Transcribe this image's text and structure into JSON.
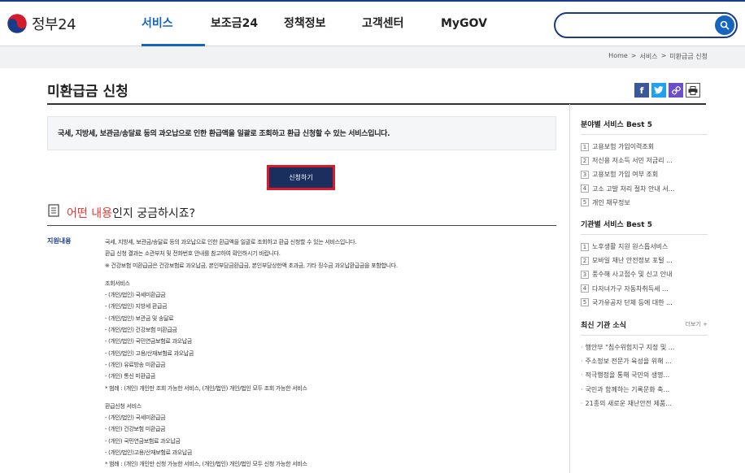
{
  "header": {
    "brand": "정부24",
    "nav": [
      "서비스",
      "보조금24",
      "정책정보",
      "고객센터",
      "MyGOV"
    ],
    "active_nav": "서비스",
    "search_placeholder": ""
  },
  "breadcrumb": [
    "Home",
    ">",
    "서비스",
    ">",
    "미환급금 신청"
  ],
  "page": {
    "title": "미환급금 신청",
    "summary": "국세, 지방세, 보관금/송달료 등의 과오납으로 인한 환급액을 일괄로 조회하고 환급 신청할 수 있는 서비스입니다.",
    "apply_label": "신청하기",
    "section_prefix": "어떤 내용",
    "section_suffix": "인지 궁금하시죠?"
  },
  "details": {
    "label": "지원내용",
    "lines": [
      "국세, 지방세, 보관금/송달료 등의 과오납으로 인한 환급액을 일괄로 조회하고 환급 신청할 수 있는 서비스입니다.",
      "환급 신청 결과는 소관부처 및 전화번호 안내를 참고하여 확인하시기 바랍니다.",
      "※ 건강보험 미환급금은 건강보험료 과오납금, 본인부담금환급금, 본인부담상한액 초과금, 기타 징수금 과오납환급금을 포함합니다.",
      "",
      "조회서비스",
      "- (개인/법인) 국세미환급금",
      "- (개인/법인) 지방세 환급금",
      "- (개인/법인) 보관금 및 송달료",
      "- (개인/법인) 건강보험 미환급금",
      "- (개인/법인) 국민연금보험료 과오납금",
      "- (개인/법인) 고용/산재보험료 과오납금",
      "- (개인) 유료방송 미환급금",
      "- (개인) 통신 미환급금",
      "* 범례 : (개인) 개인만 조회 가능한 서비스, (개인/법인) 개인/법인 모두 조회 가능한 서비스",
      "",
      "환급신청 서비스",
      "- (개인/법인) 국세미환급금",
      "- (개인) 건강보험 미환급금",
      "- (개인) 국민연금보험료 과오납금",
      "- (개인/법인)고용/산재보험료 과오납금",
      "* 범례 : (개인) 개인만 신청 가능한 서비스, (개인/법인) 개인/법인 모두 신청 가능한 서비스"
    ]
  },
  "sidebar": {
    "best_by_field": {
      "title": "분야별 서비스 Best 5",
      "items": [
        "고용보험 가입이력조회",
        "저신용 저소득 서민 저금리 ...",
        "고용보험 가입 여부 조회",
        "고소 고발 처리 절차 안내 서...",
        "개인 채무정보"
      ]
    },
    "best_by_agency": {
      "title": "기관별 서비스 Best 5",
      "items": [
        "노후생활 지원 원스톱서비스",
        "모바일 재난 안전정보 포털 ...",
        "풍수해 사고접수 및 신고 안내",
        "다자녀가구 자동차취득세 ...",
        "국가유공자 단체 등에 대한 ..."
      ]
    },
    "news": {
      "title": "최신 기관 소식",
      "more": "더보기 +",
      "items": [
        "행안부 \"침수위험지구 지정 및 ...",
        "주소정보 전문가 육성을 위해 ...",
        "적극행정을 통해 국민의 생명...",
        "국민과 함께하는 기록문화 축...",
        "21종의 새로운 재난안전 제품..."
      ]
    }
  },
  "colors": {
    "accent": "#1565c0",
    "navy": "#1b2f5e",
    "highlight_red": "#e53935"
  }
}
